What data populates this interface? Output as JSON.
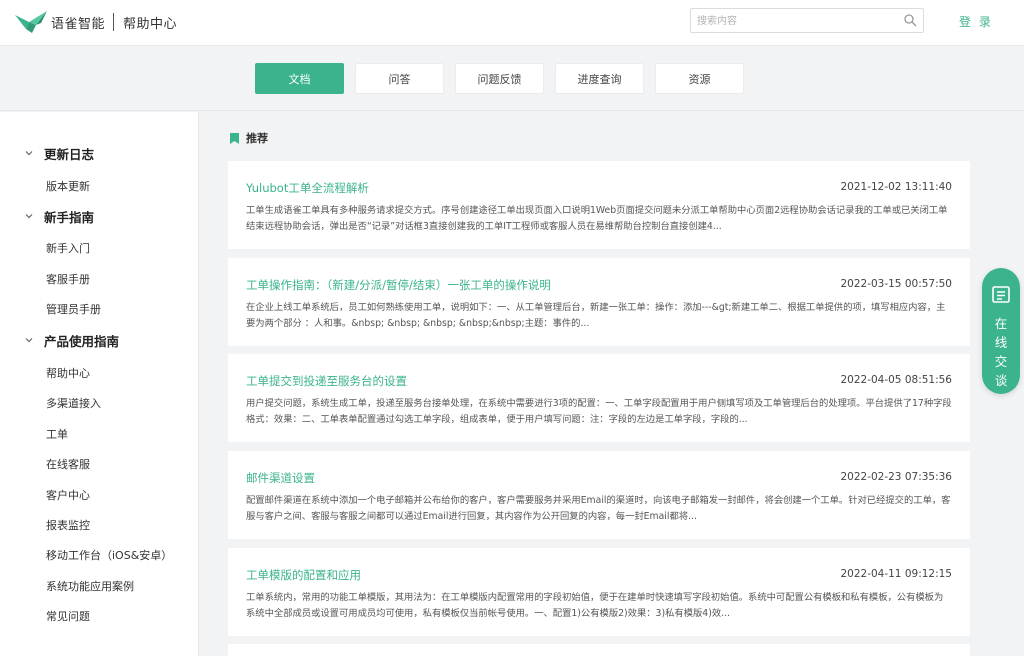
{
  "header": {
    "brand": "语雀智能",
    "subtitle": "帮助中心",
    "search_placeholder": "搜索内容",
    "login_label": "登 录"
  },
  "tabs": [
    {
      "label": "文档",
      "active": true
    },
    {
      "label": "问答",
      "active": false
    },
    {
      "label": "问题反馈",
      "active": false
    },
    {
      "label": "进度查询",
      "active": false
    },
    {
      "label": "资源",
      "active": false
    }
  ],
  "sidebar": {
    "groups": [
      {
        "label": "更新日志",
        "items": [
          "版本更新"
        ]
      },
      {
        "label": "新手指南",
        "items": [
          "新手入门",
          "客服手册",
          "管理员手册"
        ]
      },
      {
        "label": "产品使用指南",
        "items": [
          "帮助中心",
          "多渠道接入",
          "工单",
          "在线客服",
          "客户中心",
          "报表监控",
          "移动工作台（iOS&安卓）",
          "系统功能应用案例",
          "常见问题"
        ]
      }
    ]
  },
  "main": {
    "section_label": "推荐",
    "articles": [
      {
        "title": "Yulubot工单全流程解析",
        "date": "2021-12-02 13:11:40",
        "desc": "工单生成语雀工单具有多种服务请求提交方式。序号创建途径工单出现页面入口说明1Web页面提交问题未分派工单帮助中心页面2远程协助会话记录我的工单或已关闭工单结束远程协助会话，弹出是否“记录”对话框3直接创建我的工单IT工程师或客服人员在易维帮助台控制台直接创建4..."
      },
      {
        "title": "工单操作指南：（新建/分派/暂停/结束）一张工单的操作说明",
        "date": "2022-03-15 00:57:50",
        "desc": "在企业上线工单系统后，员工如何熟练使用工单，说明如下：一、从工单管理后台，新建一张工单：操作：添加---&gt;新建工单二、根据工单提供的项，填写相应内容，主要为两个部分 ：人和事。&nbsp; &nbsp; &nbsp; &nbsp;&nbsp;主题：事件的..."
      },
      {
        "title": "工单提交到投递至服务台的设置",
        "date": "2022-04-05 08:51:56",
        "desc": "用户提交问题，系统生成工单，投递至服务台接单处理，在系统中需要进行3项的配置：一、工单字段配置用于用户侧填写项及工单管理后台的处理项。平台提供了17种字段格式：效果：二、工单表单配置通过勾选工单字段，组成表单，便于用户填写问题：注：字段的左边是工单字段，字段的..."
      },
      {
        "title": "邮件渠道设置",
        "date": "2022-02-23 07:35:36",
        "desc": "配置邮件渠道在系统中添加一个电子邮箱并公布给你的客户，客户需要服务并采用Email的渠道时，向该电子邮箱发一封邮件，将会创建一个工单。针对已经提交的工单，客服与客户之间、客服与客服之间都可以通过Email进行回复，其内容作为公开回复的内容，每一封Email都将..."
      },
      {
        "title": "工单模版的配置和应用",
        "date": "2022-04-11 09:12:15",
        "desc": "工单系统内，常用的功能工单模版，其用法为：在工单模版内配置常用的字段初始值，便于在建单时快速填写字段初始值。系统中可配置公有模板和私有模板，公有模板为系统中全部成员或设置可用成员均可使用，私有模板仅当前帐号使用。一、配置1)公有模版2)效果：3)私有模版4)效..."
      }
    ]
  },
  "chat": {
    "label_chars": [
      "在",
      "线",
      "交",
      "谈"
    ]
  },
  "colors": {
    "accent": "#3bb38e",
    "page_bg": "#f2f3f5"
  }
}
